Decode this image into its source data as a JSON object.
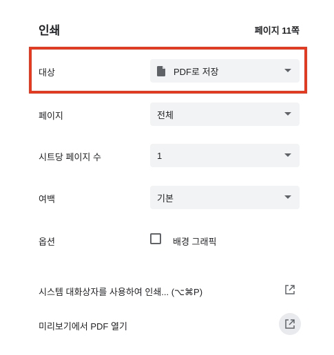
{
  "header": {
    "title": "인쇄",
    "page_count": "페이지 11쪽"
  },
  "destination": {
    "label": "대상",
    "value": "PDF로 저장",
    "icon": "document-icon"
  },
  "pages": {
    "label": "페이지",
    "value": "전체"
  },
  "pages_per_sheet": {
    "label": "시트당 페이지 수",
    "value": "1"
  },
  "margins": {
    "label": "여백",
    "value": "기본"
  },
  "options": {
    "label": "옵션",
    "checkbox_label": "배경 그래픽",
    "checked": false
  },
  "links": {
    "system_dialog": "시스템 대화상자를 사용하여 인쇄... (⌥⌘P)",
    "open_preview": "미리보기에서 PDF 열기"
  },
  "colors": {
    "highlight": "#e8391f",
    "select_bg": "#f1f3f4"
  }
}
